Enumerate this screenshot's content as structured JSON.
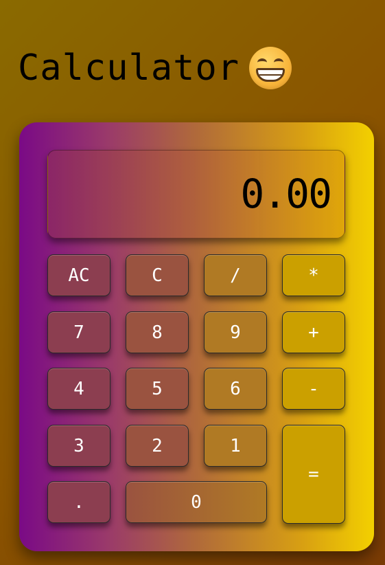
{
  "header": {
    "title": "Calculator",
    "emoji_icon": "grinning-face-with-smiling-eyes-emoji"
  },
  "display": {
    "value": "0.00"
  },
  "keys": {
    "ac": "AC",
    "clear": "C",
    "divide": "/",
    "multiply": "*",
    "seven": "7",
    "eight": "8",
    "nine": "9",
    "plus": "+",
    "four": "4",
    "five": "5",
    "six": "6",
    "minus": "-",
    "three": "3",
    "two": "2",
    "one": "1",
    "equals": "=",
    "decimal": ".",
    "zero": "0"
  },
  "colors": {
    "background": "#8a5400",
    "body_gradient_start": "#7a0a86",
    "body_gradient_end": "#f3d000",
    "key_text": "#ffffff",
    "display_text": "#000000"
  }
}
